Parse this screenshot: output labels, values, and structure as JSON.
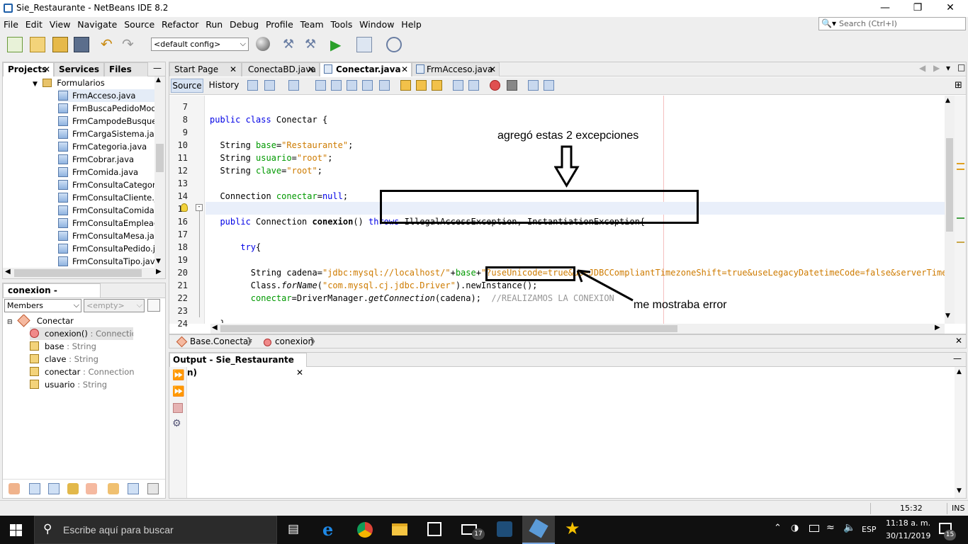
{
  "window": {
    "title": "Sie_Restaurante - NetBeans IDE 8.2"
  },
  "menu": [
    "File",
    "Edit",
    "View",
    "Navigate",
    "Source",
    "Refactor",
    "Run",
    "Debug",
    "Profile",
    "Team",
    "Tools",
    "Window",
    "Help"
  ],
  "search": {
    "placeholder": "Search (Ctrl+I)"
  },
  "toolbar": {
    "config": "<default config>"
  },
  "projects_panel": {
    "tabs": [
      "Projects",
      "Services",
      "Files"
    ],
    "folder": "Formularios",
    "files": [
      "FrmAcceso.java",
      "FrmBuscaPedidoModific",
      "FrmCampodeBusquedal",
      "FrmCargaSistema.java",
      "FrmCategoria.java",
      "FrmCobrar.java",
      "FrmComida.java",
      "FrmConsultaCategoria.",
      "FrmConsultaCliente.jav",
      "FrmConsultaComida.jav",
      "FrmConsultaEmpleado.j",
      "FrmConsultaMesa.java",
      "FrmConsultaPedido.jav",
      "FrmConsultaTipo.java"
    ]
  },
  "navigator": {
    "title": "conexion - Navigator",
    "filter": "Members",
    "empty": "<empty>",
    "class_name": "Conectar",
    "members": [
      {
        "name": "conexion()",
        "type": " : Connection"
      },
      {
        "name": "base",
        "type": " : String"
      },
      {
        "name": "clave",
        "type": " : String"
      },
      {
        "name": "conectar",
        "type": " : Connection"
      },
      {
        "name": "usuario",
        "type": " : String"
      }
    ]
  },
  "editor": {
    "tabs": [
      "Start Page",
      "ConectaBD.java",
      "Conectar.java",
      "FrmAcceso.java"
    ],
    "source_tab": "Source",
    "history_tab": "History",
    "line_numbers": [
      "7",
      "8",
      "9",
      "10",
      "11",
      "12",
      "13",
      "14",
      "15",
      "16",
      "17",
      "18",
      "19",
      "20",
      "21",
      "22",
      "23",
      "24"
    ],
    "breadcrumb": [
      "Base.Conectar",
      "conexion"
    ]
  },
  "annotations": {
    "top": "agregó estas 2 excepciones",
    "bottom": "me mostraba error"
  },
  "output": {
    "title": "Output - Sie_Restaurante (run)"
  },
  "status": {
    "position": "15:32",
    "mode": "INS"
  },
  "taskbar": {
    "search_placeholder": "Escribe aquí para buscar",
    "lang": "ESP",
    "time": "11:18 a. m.",
    "date": "30/11/2019",
    "notif_count": "15",
    "mail_badge": "17"
  }
}
